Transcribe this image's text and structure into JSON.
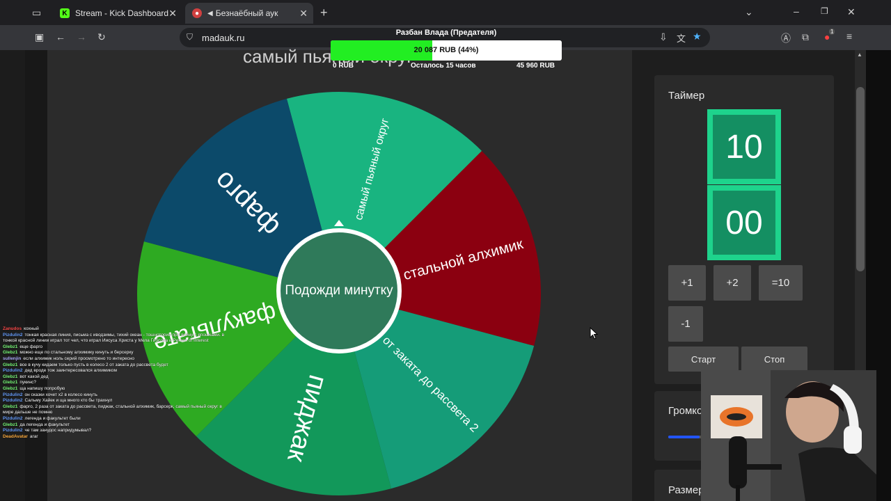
{
  "browser": {
    "tabs": [
      {
        "title": "Stream - Kick Dashboard",
        "icon": "kick-logo-icon",
        "active": false
      },
      {
        "title": "Безнаёбный аук",
        "icon": "page-favicon-icon",
        "active": true
      }
    ],
    "url": "madauk.ru",
    "new_tab_symbol": "+",
    "close_symbol": "✕",
    "extension_badge": "1"
  },
  "goal": {
    "title": "Разбан Влада (Предателя)",
    "progress_text": "20 087 RUB (44%)",
    "progress_fraction": 0.44,
    "fill_color": "#22ee22",
    "min_label": "0 RUB",
    "remaining_label": "Осталось 15 часов",
    "max_label": "45 960 RUB"
  },
  "page": {
    "heading_partial": "самый пьяный округ"
  },
  "wheel": {
    "center_text": "Подожди минутку",
    "segments": [
      {
        "label": "самый пьяный округ",
        "color": "#19b480"
      },
      {
        "label": "стальной алхимик",
        "color": "#8b0010"
      },
      {
        "label": "от заката до рассвета 2",
        "color": "#159c78"
      },
      {
        "label": "пиджак",
        "color": "#12985a"
      },
      {
        "label": "факультате",
        "color": "#2eaa22"
      },
      {
        "label": "фарго",
        "color": "#0c4a6a"
      }
    ]
  },
  "timer": {
    "label": "Таймер",
    "minutes": "10",
    "seconds": "00",
    "accent_color": "#1ed38c",
    "buttons": {
      "plus1": "+1",
      "plus2": "+2",
      "set10": "=10",
      "minus1": "-1",
      "start": "Старт",
      "stop": "Стоп"
    }
  },
  "volume": {
    "label": "Громкость",
    "level": 0.45
  },
  "wheel_size": {
    "label": "Размер колеса"
  },
  "chat": [
    {
      "user": "Zanudos",
      "color": "#ff4d4d",
      "text": "кохный"
    },
    {
      "user": "Pizdulin2",
      "color": "#6aa0ff",
      "text": "тонкая красная линия, письма с иводзимы, тихий океан - тошнотория про войну с япошками. в тонкой красной линии играл тот чел, что играл Иисуса Христа у Мела Гибсона и Person of Interest"
    },
    {
      "user": "Glebz1",
      "color": "#7dff7d",
      "text": "еще фарго"
    },
    {
      "user": "Glebz1",
      "color": "#7dff7d",
      "text": "можно еще по стальному алхимику кинуть и берсерку"
    },
    {
      "user": "sullenjin",
      "color": "#b0b0ff",
      "text": "если алхимик ноль серий просмотрено то интересно"
    },
    {
      "user": "Glebz1",
      "color": "#7dff7d",
      "text": "все в кучу кидаем только пусть в колесо 2 от заката до рассвета будет"
    },
    {
      "user": "Pizdulin2",
      "color": "#6aa0ff",
      "text": "дед вроде тож заинтересовался алхимиком"
    },
    {
      "user": "Glebz1",
      "color": "#7dff7d",
      "text": "вот какой дед"
    },
    {
      "user": "Glebz1",
      "color": "#7dff7d",
      "text": "пукинс?"
    },
    {
      "user": "Glebz1",
      "color": "#7dff7d",
      "text": "ща напишу попробую"
    },
    {
      "user": "Pizdulin2",
      "color": "#6aa0ff",
      "text": "он сказки хочет х2 в колесо кинуть"
    },
    {
      "user": "Pizdulin2",
      "color": "#6aa0ff",
      "text": "Сальму Хайек и ща много кто бы трахнул"
    },
    {
      "user": "Glebz1",
      "color": "#7dff7d",
      "text": "фарго, 2 раза от заката до рассвета, пиджак, стальной алхимик, барсерк, самый пьяный округ в мире дальше не помню"
    },
    {
      "user": "Pizdulin2",
      "color": "#6aa0ff",
      "text": "легенда и факультет были"
    },
    {
      "user": "Glebz1",
      "color": "#7dff7d",
      "text": "да легенда и факультет"
    },
    {
      "user": "Pizdulin2",
      "color": "#6aa0ff",
      "text": "че там занудос напридумывал?"
    },
    {
      "user": "DeadAvatar",
      "color": "#ffae42",
      "text": "агаг"
    }
  ]
}
